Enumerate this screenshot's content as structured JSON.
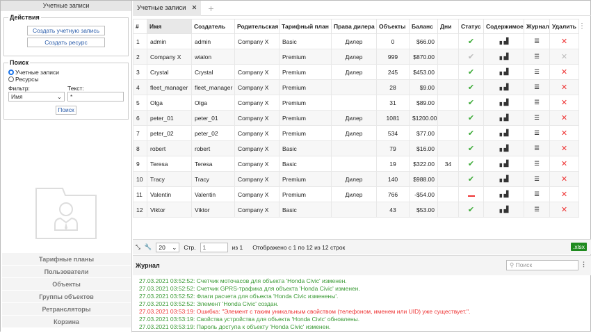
{
  "sidebar": {
    "title": "Учетные записи",
    "actions_legend": "Действия",
    "create_account": "Создать учетную запись",
    "create_resource": "Создать ресурс",
    "search_legend": "Поиск",
    "radio_accounts": "Учетные записи",
    "radio_resources": "Ресурсы",
    "filter_label": "Фильтр:",
    "filter_value": "Имя",
    "text_label": "Текст:",
    "text_value": "*",
    "search_button": "Поиск",
    "nav": [
      "Тарифные планы",
      "Пользователи",
      "Объекты",
      "Группы объектов",
      "Ретрансляторы",
      "Корзина"
    ]
  },
  "tabs": {
    "active": "Учетные записи",
    "close": "✕",
    "add": "+"
  },
  "table": {
    "headers": [
      "#",
      "Имя",
      "Создатель",
      "Родительская",
      "Тарифный план",
      "Права дилера",
      "Объекты",
      "Баланс",
      "Дни",
      "Статус",
      "Содержимое",
      "Журнал",
      "Удалить"
    ],
    "rows": [
      [
        "1",
        "admin",
        "admin",
        "Company X",
        "Basic",
        "Дилер",
        "0",
        "$66.00",
        "",
        "ok",
        "ok"
      ],
      [
        "2",
        "Company X",
        "wialon",
        "",
        "Premium",
        "Дилер",
        "999",
        "$870.00",
        "",
        "disabled",
        "disabled"
      ],
      [
        "3",
        "Crystal",
        "Crystal",
        "Company X",
        "Premium",
        "Дилер",
        "245",
        "$453.00",
        "",
        "ok",
        "ok"
      ],
      [
        "4",
        "fleet_manager",
        "fleet_manager",
        "Company X",
        "Premium",
        "",
        "28",
        "$9.00",
        "",
        "ok",
        "ok"
      ],
      [
        "5",
        "Olga",
        "Olga",
        "Company X",
        "Premium",
        "",
        "31",
        "$89.00",
        "",
        "ok",
        "ok"
      ],
      [
        "6",
        "peter_01",
        "peter_01",
        "Company X",
        "Premium",
        "Дилер",
        "1081",
        "$1200.00",
        "",
        "ok",
        "ok"
      ],
      [
        "7",
        "peter_02",
        "peter_02",
        "Company X",
        "Premium",
        "Дилер",
        "534",
        "$77.00",
        "",
        "ok",
        "ok"
      ],
      [
        "8",
        "robert",
        "robert",
        "Company X",
        "Basic",
        "",
        "79",
        "$16.00",
        "",
        "ok",
        "ok"
      ],
      [
        "9",
        "Teresa",
        "Teresa",
        "Company X",
        "Basic",
        "",
        "19",
        "$322.00",
        "34",
        "ok",
        "ok"
      ],
      [
        "10",
        "Tracy",
        "Tracy",
        "Company X",
        "Premium",
        "Дилер",
        "140",
        "$988.00",
        "",
        "ok",
        "ok"
      ],
      [
        "11",
        "Valentin",
        "Valentin",
        "Company X",
        "Premium",
        "Дилер",
        "766",
        "-$54.00",
        "",
        "blocked",
        "ok"
      ],
      [
        "12",
        "Viktor",
        "Viktor",
        "Company X",
        "Basic",
        "",
        "43",
        "$53.00",
        "",
        "ok",
        "ok"
      ]
    ]
  },
  "pager": {
    "page_size": "20",
    "page_label": "Стр.",
    "page_value": "1",
    "of": "из 1",
    "summary": "Отображено с 1 по 12 из 12 строк",
    "export": ".xlsx"
  },
  "log": {
    "title": "Журнал",
    "search_placeholder": "Поиск",
    "lines": [
      {
        "text": "27.03.2021 03:52:52: Счетчик моточасов для объекта 'Honda Civic' изменен.",
        "type": "info"
      },
      {
        "text": "27.03.2021 03:52:52: Счетчик GPRS-трафика для объекта 'Honda Civic' изменен.",
        "type": "info"
      },
      {
        "text": "27.03.2021 03:52:52: Флаги расчета для объекта 'Honda Civic изменены'.",
        "type": "info"
      },
      {
        "text": "27.03.2021 03:52:52: Элемент 'Honda Civic' создан.",
        "type": "info"
      },
      {
        "text": "27.03.2021 03:53:19: Ошибка: \"Элемент с таким уникальным свойством (телефоном, именем или UID) уже существует.\".",
        "type": "error"
      },
      {
        "text": "27.03.2021 03:53:19: Свойства устройства для объекта 'Honda Civic' обновлены.",
        "type": "info"
      },
      {
        "text": "27.03.2021 03:53:19: Пароль доступа к объекту 'Honda Civic' изменен.",
        "type": "info"
      }
    ]
  }
}
